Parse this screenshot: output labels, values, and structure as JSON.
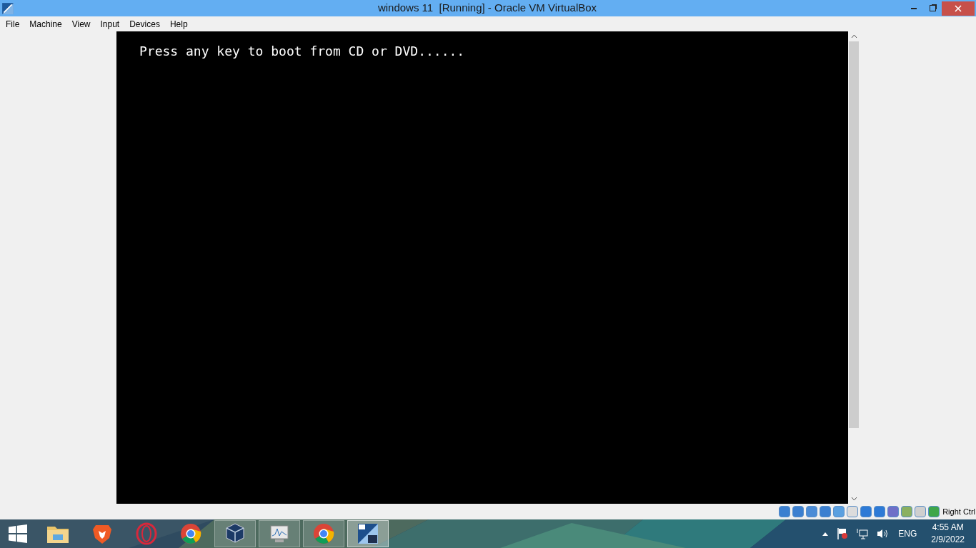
{
  "window": {
    "title": "windows 11  [Running] - Oracle VM VirtualBox"
  },
  "menu": [
    "File",
    "Machine",
    "View",
    "Input",
    "Devices",
    "Help"
  ],
  "screen": {
    "text": "Press any key to boot from CD or DVD......"
  },
  "status_bar": {
    "host_key": "Right Ctrl"
  },
  "taskbar": {
    "items": [
      {
        "running": false,
        "selected": false
      },
      {
        "running": false,
        "selected": false
      },
      {
        "running": false,
        "selected": false
      },
      {
        "running": false,
        "selected": false
      },
      {
        "running": true,
        "selected": false
      },
      {
        "running": true,
        "selected": false
      },
      {
        "running": true,
        "selected": false
      },
      {
        "running": true,
        "selected": true
      }
    ],
    "language": "ENG",
    "time": "4:55 AM",
    "date": "2/9/2022"
  }
}
